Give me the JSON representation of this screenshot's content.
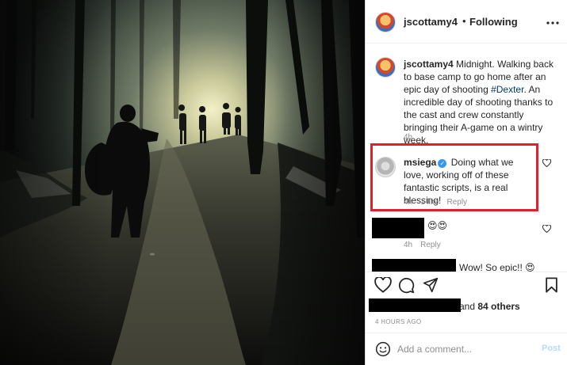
{
  "post": {
    "username": "jscottamy4",
    "separator": "•",
    "follow_status": "Following",
    "more_icon": "more-horizontal-icon"
  },
  "caption": {
    "username": "jscottamy4",
    "text_before": " Midnight. Walking back to base camp to go home after an epic day of shooting ",
    "hashtag": "#Dexter",
    "text_after": ". An incredible day of shooting thanks to the cast and crew constantly bringing their A-game on a wintry week.",
    "time": "4h"
  },
  "comments": [
    {
      "username": "msiega",
      "verified": true,
      "text": " Doing what we love, working off of these fantastic scripts, is a real blessing!",
      "time": "4h",
      "likes": "1 like",
      "reply": "Reply",
      "highlighted": true
    },
    {
      "username": "",
      "text": "😍😍",
      "time": "4h",
      "reply": "Reply"
    },
    {
      "username": "",
      "text": "Wow! So epic!! 😍"
    }
  ],
  "likes_summary": {
    "and_text": "and",
    "others": "84 others"
  },
  "posted_ago": "4 HOURS AGO",
  "comment_box": {
    "placeholder": "Add a comment...",
    "post_label": "Post"
  },
  "colors": {
    "highlight_border": "#e0202a",
    "link": "#00376b",
    "verified": "#3897f0",
    "post_disabled": "#b3dbff"
  }
}
